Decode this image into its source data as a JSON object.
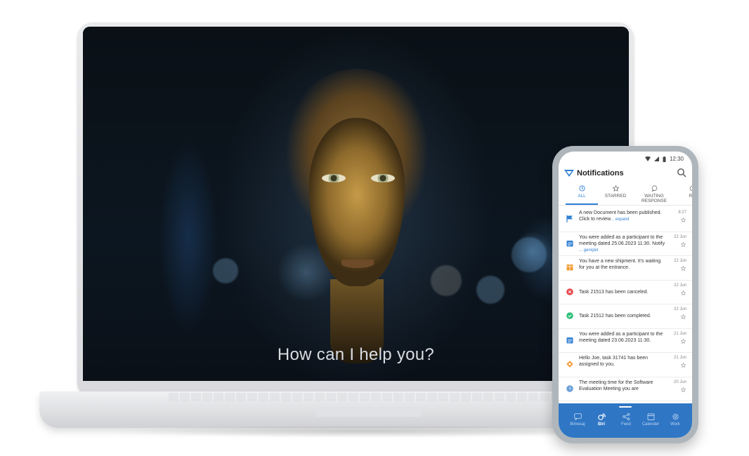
{
  "laptop": {
    "caption": "How can I help you?"
  },
  "phone": {
    "status": {
      "time": "12:30"
    },
    "header": {
      "title": "Notifications"
    },
    "tabs": [
      {
        "label": "ALL",
        "icon": "history-icon",
        "active": true
      },
      {
        "label": "STARRED",
        "icon": "star-icon",
        "active": false
      },
      {
        "label": "WAITING RESPONSE",
        "icon": "chat-bubble-icon",
        "active": false
      },
      {
        "label": "RE",
        "icon": "partial-tab-icon",
        "active": false
      }
    ],
    "notifications": [
      {
        "icon": "flag-icon",
        "color": "#2f7fd2",
        "text": "A new Document has been published. Click to review",
        "more": "... expand",
        "date": "8:27"
      },
      {
        "icon": "calendar-icon",
        "color": "#2f7fd2",
        "text": "You were added as a participant to the meeting dated 25.06.2023 11:30. Notify",
        "more": "... genişlet",
        "date": "22 Jun"
      },
      {
        "icon": "package-icon",
        "color": "#f29a2e",
        "text": "You have a new shipment. It's waiting for you at the entrance.",
        "more": "",
        "date": "22 Jun"
      },
      {
        "icon": "cancel-icon",
        "color": "#e5484d",
        "text": "Task 21513 has been canceled.",
        "more": "",
        "date": "22 Jun"
      },
      {
        "icon": "check-icon",
        "color": "#2ebf77",
        "text": "Task 21512 has been completed.",
        "more": "",
        "date": "22 Jun"
      },
      {
        "icon": "calendar-icon",
        "color": "#2f7fd2",
        "text": "You were added as a participant to the meeting dated 23.06.2023 11:30.",
        "more": "",
        "date": "21 Jun"
      },
      {
        "icon": "task-icon",
        "color": "#f29a2e",
        "text": "Hello Joe, task 31741 has been assigned to you.",
        "more": "",
        "date": "21 Jun"
      },
      {
        "icon": "clock-icon",
        "color": "#6a9fd8",
        "text": "The meeting time for the Software Evaluation Meeting you are",
        "more": "",
        "date": "20 Jun"
      }
    ],
    "bottom_nav": [
      {
        "label": "Bimesaj",
        "icon": "message-icon",
        "active": false
      },
      {
        "label": "Biri",
        "icon": "biri-icon",
        "active": true
      },
      {
        "label": "Feed",
        "icon": "share-icon",
        "active": false
      },
      {
        "label": "Calender",
        "icon": "calendar-icon",
        "active": false
      },
      {
        "label": "Work",
        "icon": "gear-icon",
        "active": false
      }
    ]
  }
}
